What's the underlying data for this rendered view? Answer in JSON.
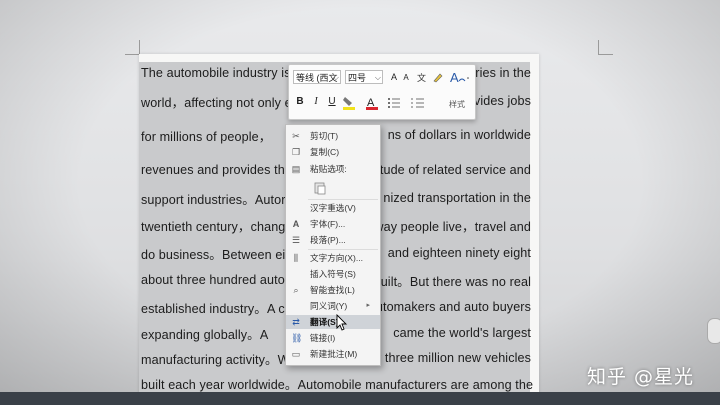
{
  "document": {
    "lines": [
      {
        "left": "The automobile industry is",
        "right": "tries in the"
      },
      {
        "left": "world，affecting not only e",
        "right": "vides jobs"
      },
      {
        "left": "for millions of people，",
        "right": "ns of dollars in worldwide"
      },
      {
        "left": "revenues and provides the",
        "right": "itude of related service and"
      },
      {
        "left": "support industries。Autor",
        "right": "nized transportation in the"
      },
      {
        "left": "twentieth century，chang",
        "right": "way people live，travel and"
      },
      {
        "left": "do business。Between ei",
        "right": "and eighteen ninety eight"
      },
      {
        "left": "about three hundred auto",
        "right": "uilt。But there was no real"
      },
      {
        "left": "established industry。A cer",
        "right": "utomakers and auto buyers"
      },
      {
        "left": "expanding globally。A",
        "right": "came the world's largest"
      },
      {
        "left": "manufacturing activity。W",
        "right": "y three million new vehicles"
      },
      {
        "left": "built each year worldwide。Automobile manufacturers are among the",
        "right": ""
      }
    ]
  },
  "mini_toolbar": {
    "font_name": "等线 (西文",
    "font_size": "四号",
    "grow_font": "A",
    "shrink_font": "A",
    "bold": "B",
    "italic": "I",
    "underline": "U",
    "styles_label": "样式"
  },
  "context_menu": {
    "items": [
      {
        "label": "剪切(T)",
        "icon": "cut-icon"
      },
      {
        "label": "复制(C)",
        "icon": "copy-icon"
      },
      {
        "label": "粘贴选项:",
        "icon": "paste-icon"
      },
      {
        "label": "汉字重选(V)",
        "icon": ""
      },
      {
        "label": "字体(F)...",
        "icon": "font-icon"
      },
      {
        "label": "段落(P)...",
        "icon": "paragraph-icon"
      },
      {
        "label": "文字方向(X)...",
        "icon": "text-direction-icon"
      },
      {
        "label": "插入符号(S)",
        "icon": ""
      },
      {
        "label": "智能查找(L)",
        "icon": "search-icon"
      },
      {
        "label": "同义词(Y)",
        "icon": ""
      },
      {
        "label": "翻译(S)",
        "icon": "translate-icon"
      },
      {
        "label": "链接(I)",
        "icon": "link-icon"
      },
      {
        "label": "新建批注(M)",
        "icon": "comment-icon"
      }
    ]
  },
  "watermark": "知乎 @星光",
  "colors": {
    "selection": "#c9cacc",
    "font_color_red": "#d9262e",
    "highlight_yellow": "#f2e21b"
  }
}
